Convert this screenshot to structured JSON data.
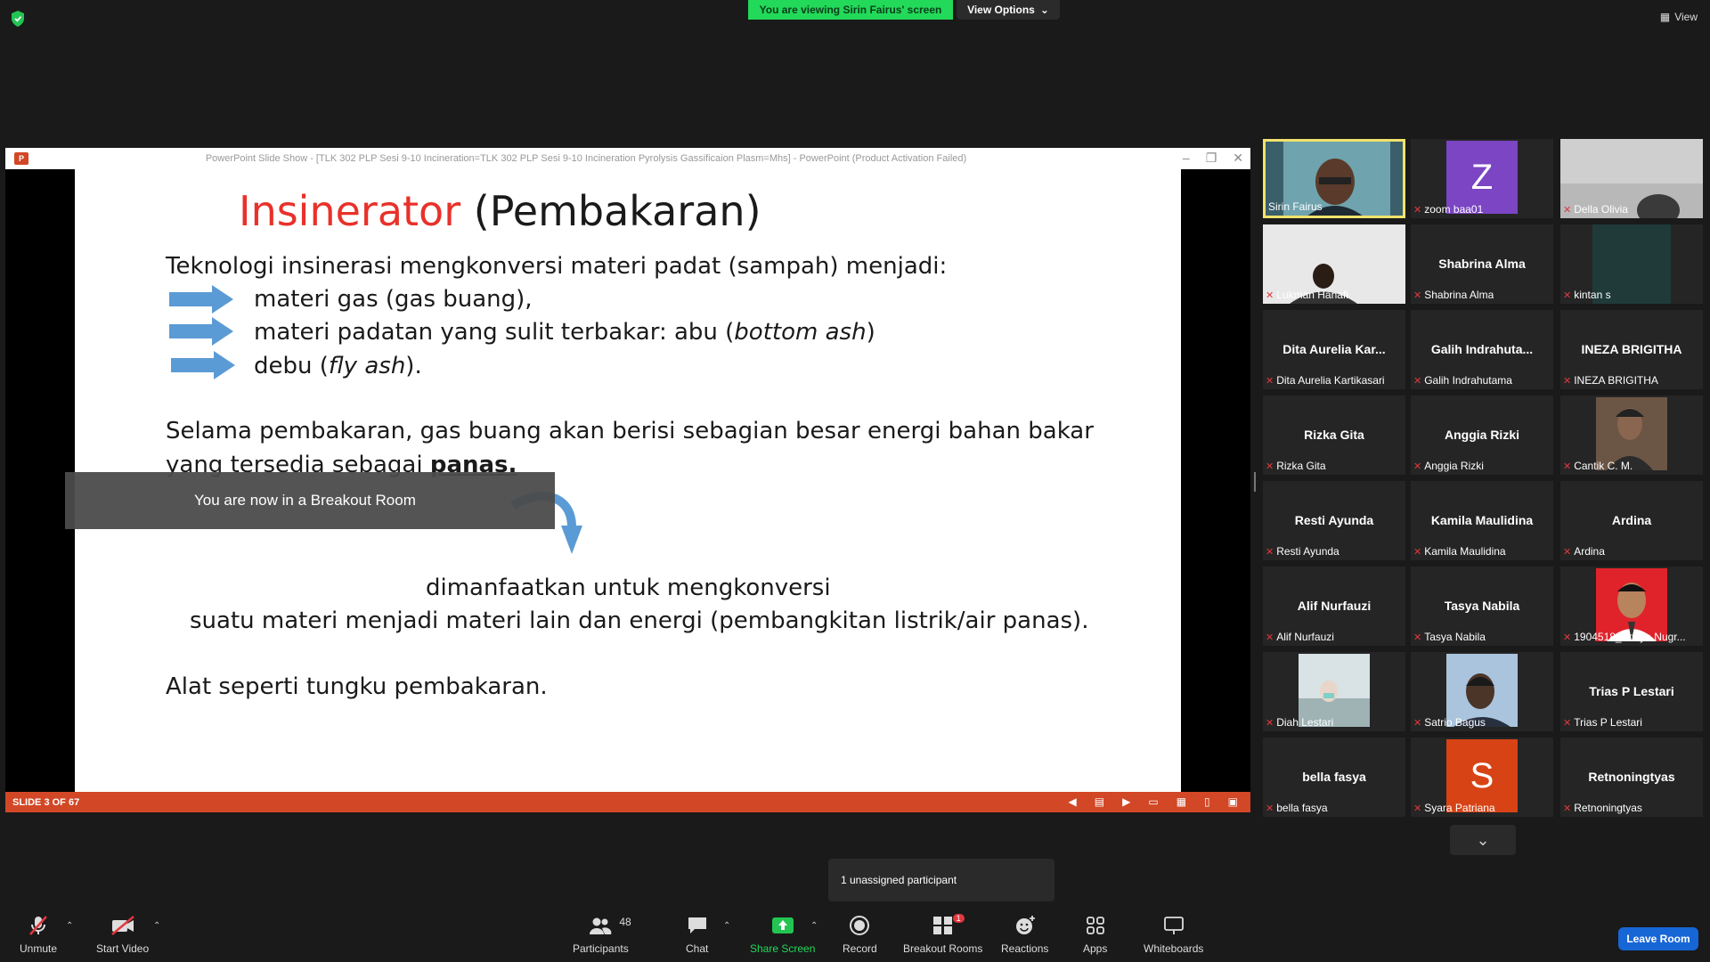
{
  "top": {
    "viewing_banner": "You are viewing Sirin Fairus' screen",
    "view_options": "View Options",
    "view_label": "View"
  },
  "ppt": {
    "window_title": "PowerPoint Slide Show - [TLK 302 PLP Sesi  9-10 Incineration=TLK 302 PLP Sesi  9-10 Incineration Pyrolysis Gassificaion Plasm=Mhs] - PowerPoint (Product Activation Failed)",
    "logo": "P",
    "status": "SLIDE 3 OF 67"
  },
  "slide": {
    "title_red": "Insinerator",
    "title_rest": " (Pembakaran)",
    "line1": "Teknologi insinerasi mengkonversi materi padat (sampah) menjadi:",
    "bullet1": "materi gas (gas buang),",
    "bullet2_a": "materi padatan yang sulit terbakar: abu (",
    "bullet2_i": "bottom ash",
    "bullet2_b": ")",
    "bullet3_a": "debu (",
    "bullet3_i": "fly ash",
    "bullet3_b": ").",
    "para2_l1": "Selama pembakaran, gas buang akan berisi sebagian besar energi bahan bakar",
    "para2_l2a": "yang tersedia sebagai ",
    "para2_l2b": "panas.",
    "para3_l1": "dimanfaatkan untuk mengkonversi",
    "para3_l2": "suatu materi menjadi materi lain dan energi (pembangkitan listrik/air panas).",
    "para4": "Alat seperti tungku pembakaran."
  },
  "toast": "You are now in a Breakout Room",
  "gallery": [
    {
      "name": "Sirin Fairus",
      "big": "",
      "muted": false,
      "photo": "video-woman"
    },
    {
      "name": "zoom baa01",
      "big": "",
      "muted": true,
      "avatar": "Z",
      "avatar_color": "#7b45c4"
    },
    {
      "name": "Della Olivia",
      "big": "",
      "muted": true,
      "photo": "video-room"
    },
    {
      "name": "Lukman Hanafi",
      "big": "",
      "muted": true,
      "photo": "video-man"
    },
    {
      "name": "Shabrina Alma",
      "big": "Shabrina Alma",
      "muted": true
    },
    {
      "name": "kintan s",
      "big": "",
      "muted": true,
      "photo": "video-dark"
    },
    {
      "name": "Dita Aurelia Kartikasari",
      "big": "Dita  Aurelia  Kar...",
      "muted": true
    },
    {
      "name": "Galih Indrahutama",
      "big": "Galih  Indrahuta...",
      "muted": true
    },
    {
      "name": "INEZA BRIGITHA",
      "big": "INEZA BRIGITHA",
      "muted": true
    },
    {
      "name": "Rizka Gita",
      "big": "Rizka Gita",
      "muted": true
    },
    {
      "name": "Anggia Rizki",
      "big": "Anggia Rizki",
      "muted": true
    },
    {
      "name": "Cantik C. M.",
      "big": "",
      "muted": true,
      "photo": "photo-person"
    },
    {
      "name": "Resti Ayunda",
      "big": "Resti Ayunda",
      "muted": true
    },
    {
      "name": "Kamila Maulidina",
      "big": "Kamila Maulidina",
      "muted": true
    },
    {
      "name": "Ardina",
      "big": "Ardina",
      "muted": true
    },
    {
      "name": "Alif Nurfauzi",
      "big": "Alif Nurfauzi",
      "muted": true
    },
    {
      "name": "Tasya Nabila",
      "big": "Tasya Nabila",
      "muted": true
    },
    {
      "name": "1904518_Aditya Nugr...",
      "big": "",
      "muted": true,
      "photo": "photo-red"
    },
    {
      "name": "Diah Lestari",
      "big": "",
      "muted": true,
      "photo": "photo-light"
    },
    {
      "name": "Satrio Bagus",
      "big": "",
      "muted": true,
      "photo": "photo-sky"
    },
    {
      "name": "Trias P Lestari",
      "big": "Trias P Lestari",
      "muted": true
    },
    {
      "name": "bella fasya",
      "big": "bella fasya",
      "muted": true
    },
    {
      "name": "Syara Patriana",
      "big": "",
      "muted": true,
      "avatar": "S",
      "avatar_color": "#d84315"
    },
    {
      "name": "Retnoningtyas",
      "big": "Retnoningtyas",
      "muted": true
    }
  ],
  "unassigned": "1 unassigned participant",
  "toolbar": {
    "unmute": "Unmute",
    "start_video": "Start Video",
    "participants": "Participants",
    "participants_count": "48",
    "chat": "Chat",
    "share_screen": "Share Screen",
    "record": "Record",
    "breakout_rooms": "Breakout Rooms",
    "breakout_badge": "1",
    "reactions": "Reactions",
    "apps": "Apps",
    "whiteboards": "Whiteboards",
    "leave_room": "Leave Room"
  },
  "colors": {
    "accent": "#1766d6",
    "share_green": "#23d959",
    "ppt_orange": "#d24726",
    "active_border": "#f0e26c",
    "muted_red": "#e0383e"
  }
}
